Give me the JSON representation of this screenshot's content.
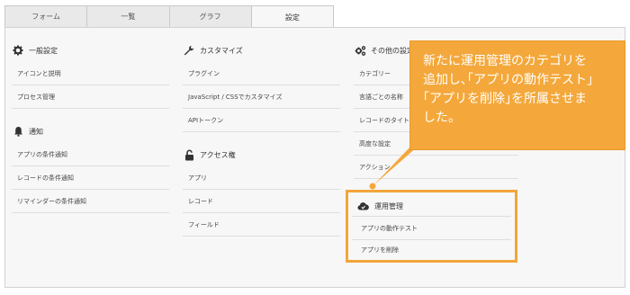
{
  "tabs": [
    {
      "label": "フォーム"
    },
    {
      "label": "一覧"
    },
    {
      "label": "グラフ"
    },
    {
      "label": "設定"
    }
  ],
  "col1": {
    "general": {
      "title": "一般設定",
      "icon": "gear-icon",
      "items": [
        "アイコンと説明",
        "プロセス管理"
      ]
    },
    "notify": {
      "title": "通知",
      "icon": "bell-icon",
      "items": [
        "アプリの条件通知",
        "レコードの条件通知",
        "リマインダーの条件通知"
      ]
    }
  },
  "col2": {
    "customize": {
      "title": "カスタマイズ",
      "icon": "wrench-icon",
      "items": [
        "プラグイン",
        "JavaScript / CSSでカスタマイズ",
        "APIトークン"
      ]
    },
    "access": {
      "title": "アクセス権",
      "icon": "lock-icon",
      "items": [
        "アプリ",
        "レコード",
        "フィールド"
      ]
    }
  },
  "col3": {
    "other": {
      "title": "その他の設定",
      "icon": "gears-icon",
      "items": [
        "カテゴリー",
        "言語ごとの名称",
        "レコードのタイトル",
        "高度な設定",
        "アクション"
      ]
    },
    "ops": {
      "title": "運用管理",
      "icon": "cloud-icon",
      "items": [
        "アプリの動作テスト",
        "アプリを削除"
      ]
    }
  },
  "callout": {
    "lines": [
      "新たに運用管理のカテゴリを",
      "追加し､｢アプリの動作テスト｣",
      "｢アプリを削除｣を所属させま",
      "した。"
    ]
  },
  "colors": {
    "accent": "#f4a83b",
    "border": "#f2a53a"
  }
}
